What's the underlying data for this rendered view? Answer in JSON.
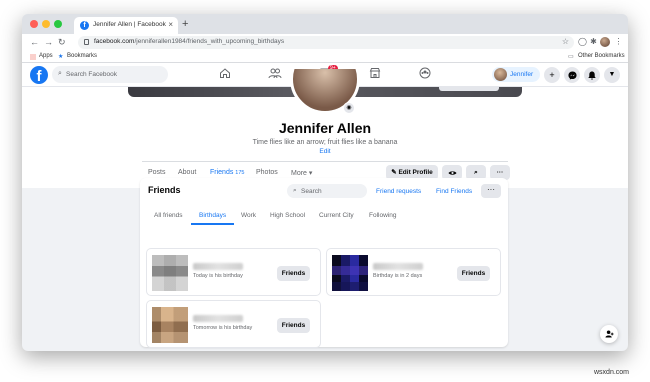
{
  "browser": {
    "tab_title": "Jennifer Allen | Facebook",
    "tab_close": "×",
    "new_tab": "+",
    "url_host": "facebook.com",
    "url_path": "/jenniferallen1984/friends_with_upcoming_birthdays",
    "bookmarks": {
      "apps": "Apps",
      "bookmarks": "Bookmarks",
      "other": "Other Bookmarks"
    },
    "traffic_colors": [
      "#ff5f57",
      "#febc2e",
      "#28c840"
    ]
  },
  "fb": {
    "brand_color": "#1877f2",
    "logo": "f",
    "search_placeholder": "Search Facebook",
    "watch_badge": "9+",
    "user_name": "Jennifer",
    "icons": [
      "home-icon",
      "friends-icon",
      "watch-icon",
      "marketplace-icon",
      "groups-icon",
      "plus-icon",
      "messenger-icon",
      "notifications-icon",
      "account-menu-icon"
    ]
  },
  "profile": {
    "name": "Jennifer Allen",
    "bio": "Time flies like an arrow; fruit flies like a banana",
    "edit_label": "Edit",
    "tabs": [
      {
        "label": "Posts"
      },
      {
        "label": "About"
      },
      {
        "label": "Friends",
        "count": "175"
      },
      {
        "label": "Photos"
      },
      {
        "label": "More ▾"
      }
    ],
    "edit_profile": "Edit Profile",
    "more_dots": "···"
  },
  "friends_card": {
    "title": "Friends",
    "search_placeholder": "Search",
    "friend_requests": "Friend requests",
    "find_friends": "Find Friends",
    "more_dots": "···",
    "tabs": [
      "All friends",
      "Birthdays",
      "Work",
      "High School",
      "Current City",
      "Following"
    ],
    "active_tab": "Birthdays",
    "items": [
      {
        "subtitle": "Today is his birthday",
        "button": "Friends"
      },
      {
        "subtitle": "Birthday is in 2 days",
        "button": "Friends"
      },
      {
        "subtitle": "Tomorrow is his birthday",
        "button": "Friends"
      }
    ]
  },
  "watermark": "wsxdn.com"
}
